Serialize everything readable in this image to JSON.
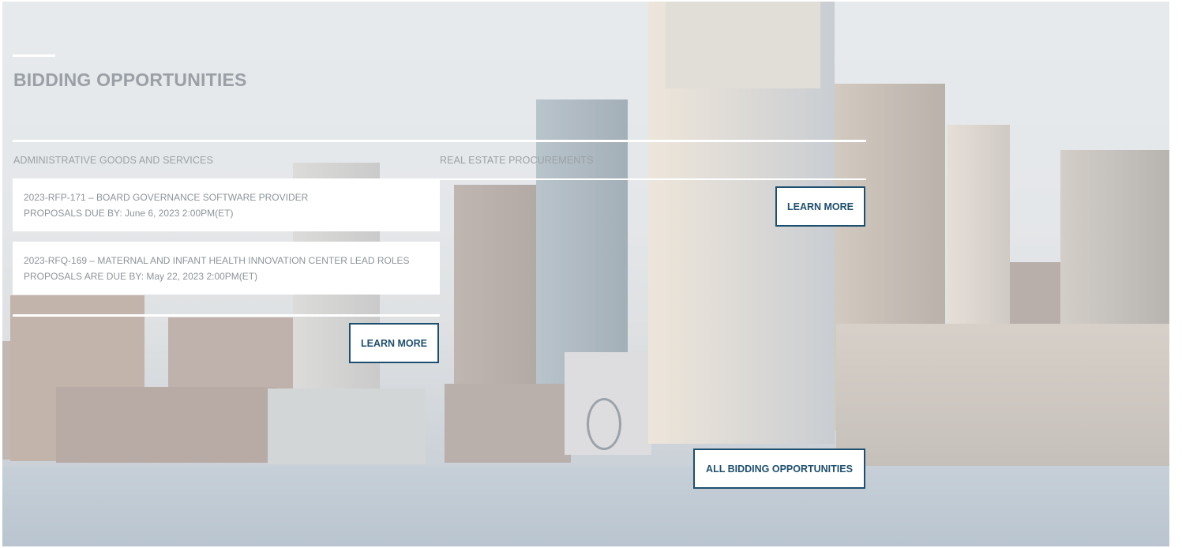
{
  "section": {
    "title": "BIDDING OPPORTUNITIES"
  },
  "columns": {
    "left_heading": "ADMINISTRATIVE GOODS AND SERVICES",
    "right_heading": "REAL ESTATE PROCUREMENTS"
  },
  "listings": [
    {
      "title": "2023-RFP-171 – BOARD GOVERNANCE SOFTWARE PROVIDER",
      "due": "PROPOSALS DUE BY: June 6, 2023 2:00PM(ET)"
    },
    {
      "title": "2023-RFQ-169 – MATERNAL AND INFANT HEALTH INNOVATION CENTER LEAD ROLES",
      "due": "PROPOSALS ARE DUE BY: May 22, 2023 2:00PM(ET)"
    }
  ],
  "buttons": {
    "learn_more_real_estate": "LEARN MORE",
    "learn_more_admin": "LEARN MORE",
    "all_bidding": "ALL BIDDING OPPORTUNITIES"
  },
  "colors": {
    "button_border": "#1e4f6f",
    "title_text": "#9aa0a6"
  }
}
